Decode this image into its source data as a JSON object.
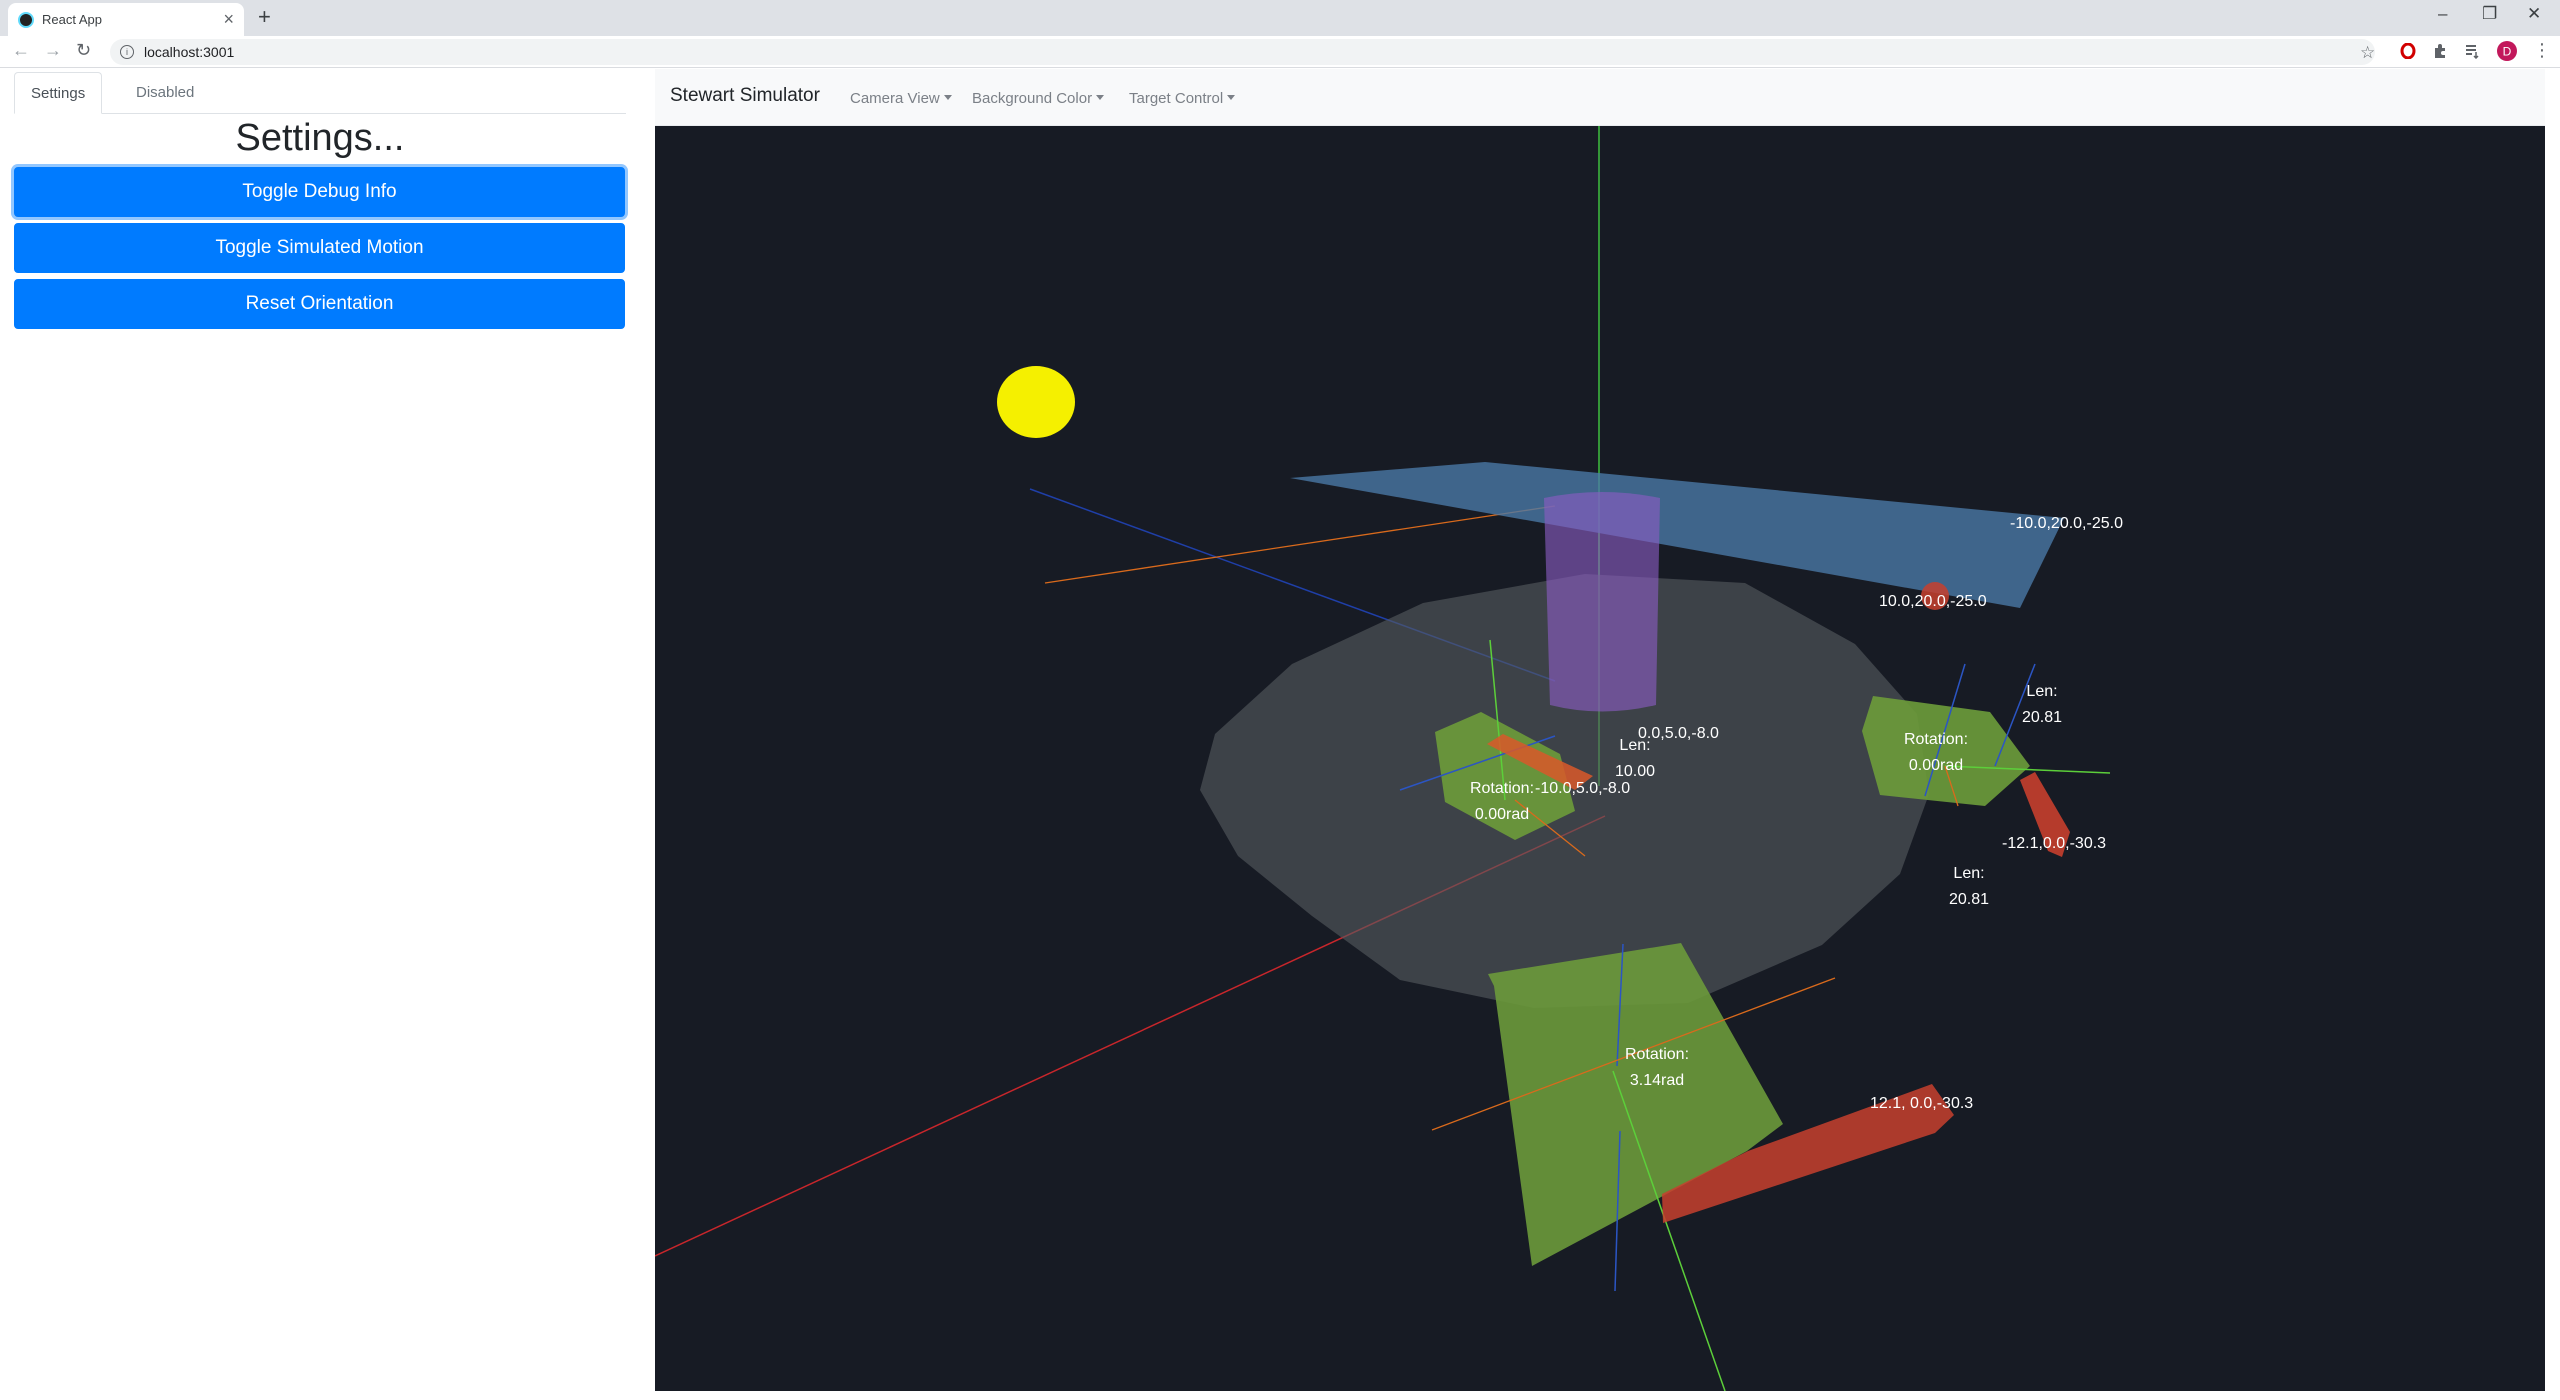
{
  "browser": {
    "tab_title": "React App",
    "tab_close": "×",
    "new_tab": "+",
    "url": "localhost:3001",
    "info_glyph": "i",
    "back_glyph": "←",
    "forward_glyph": "→",
    "reload_glyph": "↻",
    "star_glyph": "☆",
    "menu_glyph": "⋮",
    "profile_initial": "D",
    "minimize_glyph": "–",
    "restore_glyph": "❐",
    "close_glyph": "✕",
    "accent": "#c2185b"
  },
  "sidebar": {
    "tabs": [
      {
        "label": "Settings",
        "active": true
      },
      {
        "label": "Disabled",
        "active": false
      }
    ],
    "title": "Settings...",
    "buttons": [
      {
        "label": "Toggle Debug Info"
      },
      {
        "label": "Toggle Simulated Motion"
      },
      {
        "label": "Reset Orientation"
      }
    ],
    "button_color": "#007bff"
  },
  "simulator": {
    "brand": "Stewart Simulator",
    "menus": [
      {
        "label": "Camera View"
      },
      {
        "label": "Background Color"
      },
      {
        "label": "Target Control"
      }
    ],
    "background": "#171b24",
    "labels": {
      "platform_left": "-10.0,20.0,-25.0",
      "platform_right": "10.0,20.0,-25.0",
      "center_top": "0.0,5.0,-8.0",
      "center_len_title": "Len:",
      "center_len_value": "10.00",
      "center_bottom": "-10.0,5.0,-8.0",
      "rot_left_title": "Rotation:",
      "rot_left_value": "0.00rad",
      "rot_right_title": "Rotation:",
      "rot_right_value": "0.00rad",
      "len_right_title": "Len:",
      "len_right_value": "20.81",
      "right_anchor": "-12.1,0.0,-30.3",
      "len_mid_title": "Len:",
      "len_mid_value": "20.81",
      "rot_bottom_title": "Rotation:",
      "rot_bottom_value": "3.14rad",
      "bottom_anchor": "12.1, 0.0,-30.3"
    }
  }
}
